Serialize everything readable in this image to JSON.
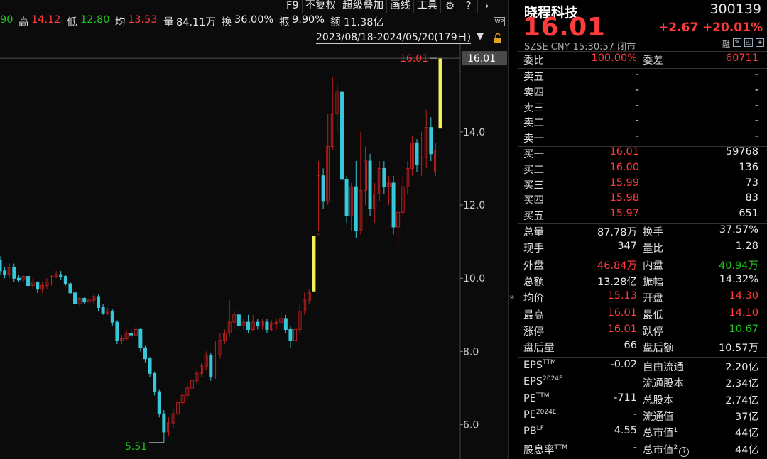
{
  "topbar": {
    "prev_close_fragment": "90",
    "high_label": "高",
    "high_value": "14.12",
    "low_label": "低",
    "low_value": "12.80",
    "avg_label": "均",
    "avg_value": "13.53",
    "vol_label": "量",
    "vol_value": "84.11万",
    "turnover_label": "换",
    "turnover_value": "36.00%",
    "amplitude_label": "振",
    "amplitude_value": "9.90%",
    "amount_label": "额",
    "amount_value": "11.38亿"
  },
  "menu": [
    "F9",
    "不复权",
    "超级叠加",
    "画线",
    "工具"
  ],
  "menu_icons": [
    "gear-icon",
    "help-icon",
    "chevron-right-icon"
  ],
  "date_range": "2023/08/18-2024/05/20(179日)",
  "wp_badge": "WP",
  "chart_data": {
    "type": "candlestick",
    "y_axis_ticks": [
      "14.0",
      "12.0",
      "10.0",
      "8.0",
      "6.0"
    ],
    "y_axis_tick_values": [
      14,
      12,
      10,
      8,
      6
    ],
    "ylim": [
      5.1,
      16.4
    ],
    "last_price_label": "16.01",
    "last_price_axis_label": "16.01",
    "min_label": "5.51",
    "min_value": 5.51,
    "up_color": "#b81e1e",
    "down_color": "#36c8d8",
    "limit_up_color": "#f4ee5a",
    "candles": [
      [
        10.5,
        10.2,
        10.6,
        10.1
      ],
      [
        10.2,
        10.1,
        10.3,
        10.0
      ],
      [
        10.1,
        10.3,
        10.4,
        10.0
      ],
      [
        10.3,
        10.0,
        10.4,
        9.9
      ],
      [
        10.0,
        9.95,
        10.1,
        9.9
      ],
      [
        9.95,
        10.05,
        10.1,
        9.9
      ],
      [
        10.05,
        9.8,
        10.1,
        9.7
      ],
      [
        9.8,
        9.9,
        10.0,
        9.7
      ],
      [
        9.9,
        9.7,
        9.9,
        9.6
      ],
      [
        9.7,
        9.8,
        9.9,
        9.6
      ],
      [
        9.8,
        9.9,
        10.0,
        9.7
      ],
      [
        9.9,
        10.05,
        10.1,
        9.8
      ],
      [
        10.05,
        10.1,
        10.2,
        10.0
      ],
      [
        10.1,
        10.05,
        10.2,
        9.95
      ],
      [
        10.05,
        9.85,
        10.1,
        9.8
      ],
      [
        9.85,
        9.6,
        9.9,
        9.55
      ],
      [
        9.6,
        9.3,
        9.7,
        9.25
      ],
      [
        9.3,
        9.45,
        9.5,
        9.25
      ],
      [
        9.45,
        9.35,
        9.5,
        9.3
      ],
      [
        9.35,
        9.4,
        9.5,
        9.3
      ],
      [
        9.4,
        9.5,
        9.55,
        9.3
      ],
      [
        9.5,
        9.2,
        9.55,
        9.1
      ],
      [
        9.2,
        9.05,
        9.3,
        9.0
      ],
      [
        9.05,
        9.1,
        9.2,
        9.0
      ],
      [
        9.1,
        8.8,
        9.15,
        8.7
      ],
      [
        8.8,
        8.3,
        8.85,
        8.2
      ],
      [
        8.3,
        8.35,
        8.45,
        8.2
      ],
      [
        8.35,
        8.5,
        8.6,
        8.3
      ],
      [
        8.5,
        8.45,
        8.6,
        8.35
      ],
      [
        8.45,
        8.6,
        8.7,
        8.4
      ],
      [
        8.6,
        8.1,
        8.65,
        8.0
      ],
      [
        8.1,
        7.8,
        8.15,
        7.7
      ],
      [
        7.8,
        7.4,
        7.85,
        7.3
      ],
      [
        7.4,
        6.9,
        7.45,
        6.8
      ],
      [
        6.9,
        6.3,
        6.95,
        6.2
      ],
      [
        6.3,
        5.8,
        6.4,
        5.51
      ],
      [
        5.8,
        6.05,
        6.2,
        5.7
      ],
      [
        6.05,
        6.3,
        6.4,
        5.9
      ],
      [
        6.3,
        6.6,
        6.7,
        6.2
      ],
      [
        6.6,
        6.8,
        6.9,
        6.5
      ],
      [
        6.8,
        7.0,
        7.1,
        6.7
      ],
      [
        7.0,
        7.2,
        7.3,
        6.9
      ],
      [
        7.2,
        7.4,
        7.5,
        7.1
      ],
      [
        7.4,
        7.6,
        7.7,
        7.3
      ],
      [
        7.6,
        7.9,
        8.0,
        7.5
      ],
      [
        7.9,
        7.3,
        7.95,
        7.2
      ],
      [
        7.3,
        7.9,
        8.3,
        7.25
      ],
      [
        7.9,
        8.3,
        8.5,
        7.8
      ],
      [
        8.3,
        8.5,
        8.6,
        8.2
      ],
      [
        8.5,
        8.8,
        9.4,
        8.4
      ],
      [
        8.8,
        9.0,
        9.1,
        8.6
      ],
      [
        9.0,
        8.7,
        9.1,
        8.6
      ],
      [
        8.7,
        8.8,
        8.9,
        8.6
      ],
      [
        8.8,
        8.6,
        9.0,
        8.5
      ],
      [
        8.6,
        8.8,
        9.0,
        8.55
      ],
      [
        8.8,
        8.7,
        8.9,
        8.6
      ],
      [
        8.7,
        8.8,
        8.9,
        8.6
      ],
      [
        8.8,
        8.6,
        8.9,
        8.5
      ],
      [
        8.6,
        8.75,
        8.85,
        8.55
      ],
      [
        8.75,
        8.8,
        8.9,
        8.6
      ],
      [
        8.8,
        8.9,
        9.1,
        8.7
      ],
      [
        8.9,
        8.6,
        9.0,
        8.5
      ],
      [
        8.6,
        8.3,
        8.7,
        8.1
      ],
      [
        8.3,
        8.6,
        8.7,
        8.2
      ],
      [
        8.6,
        9.1,
        9.3,
        8.5
      ],
      [
        9.1,
        9.4,
        9.6,
        9.0
      ],
      [
        9.4,
        9.6,
        9.7,
        9.3
      ],
      [
        9.65,
        11.15,
        11.15,
        9.65
      ],
      [
        11.2,
        12.8,
        13.2,
        11.3
      ],
      [
        12.8,
        12.1,
        13.0,
        11.9
      ],
      [
        12.1,
        13.6,
        14.5,
        12.0
      ],
      [
        13.6,
        14.5,
        15.5,
        13.5
      ],
      [
        14.5,
        15.1,
        15.3,
        14.0
      ],
      [
        15.1,
        12.7,
        15.2,
        12.5
      ],
      [
        12.7,
        11.7,
        12.8,
        11.5
      ],
      [
        11.7,
        12.5,
        12.6,
        11.3
      ],
      [
        12.5,
        11.3,
        13.2,
        11.1
      ],
      [
        11.3,
        12.4,
        14.0,
        11.2
      ],
      [
        12.4,
        13.2,
        13.6,
        12.0
      ],
      [
        13.2,
        11.9,
        13.4,
        11.7
      ],
      [
        11.9,
        12.3,
        12.6,
        11.5
      ],
      [
        12.3,
        13.0,
        13.2,
        12.1
      ],
      [
        13.0,
        12.5,
        13.2,
        12.3
      ],
      [
        12.5,
        12.6,
        12.8,
        12.0
      ],
      [
        12.6,
        11.4,
        12.8,
        11.2
      ],
      [
        11.4,
        11.8,
        12.8,
        10.9
      ],
      [
        11.8,
        12.5,
        12.8,
        11.7
      ],
      [
        12.5,
        13.0,
        13.2,
        12.3
      ],
      [
        13.0,
        13.7,
        13.9,
        12.8
      ],
      [
        13.7,
        13.1,
        13.8,
        12.9
      ],
      [
        13.1,
        13.3,
        14.0,
        12.8
      ],
      [
        13.3,
        14.12,
        14.6,
        13.0
      ],
      [
        14.12,
        13.4,
        14.4,
        13.2
      ],
      [
        12.9,
        13.5,
        13.7,
        12.8
      ],
      [
        14.1,
        16.01,
        16.01,
        14.1
      ]
    ]
  },
  "panel": {
    "name": "晓程科技",
    "code": "300139",
    "price": "16.01",
    "change": "+2.67",
    "change_pct": "+20.01%",
    "meta": "SZSE CNY 15:30:57 闭市",
    "icons": [
      "融",
      "pencil-icon",
      "expand-icon",
      "plus-icon"
    ],
    "ratio_label": "委比",
    "ratio_value": "100.00%",
    "diff_label": "委差",
    "diff_value": "60711",
    "asks": [
      {
        "label": "卖五",
        "price": "-",
        "vol": "-"
      },
      {
        "label": "卖四",
        "price": "-",
        "vol": "-"
      },
      {
        "label": "卖三",
        "price": "-",
        "vol": "-"
      },
      {
        "label": "卖二",
        "price": "-",
        "vol": "-"
      },
      {
        "label": "卖一",
        "price": "-",
        "vol": "-"
      }
    ],
    "bids": [
      {
        "label": "买一",
        "price": "16.01",
        "vol": "59768"
      },
      {
        "label": "买二",
        "price": "16.00",
        "vol": "136"
      },
      {
        "label": "买三",
        "price": "15.99",
        "vol": "73"
      },
      {
        "label": "买四",
        "price": "15.98",
        "vol": "83"
      },
      {
        "label": "买五",
        "price": "15.97",
        "vol": "651"
      }
    ],
    "stats": [
      {
        "l1": "总量",
        "v1": "87.78万",
        "c1": "white",
        "l2": "换手",
        "v2": "37.57%",
        "c2": "white"
      },
      {
        "l1": "现手",
        "v1": "347",
        "c1": "white",
        "l2": "量比",
        "v2": "1.28",
        "c2": "white"
      },
      {
        "l1": "外盘",
        "v1": "46.84万",
        "c1": "red",
        "l2": "内盘",
        "v2": "40.94万",
        "c2": "green"
      },
      {
        "l1": "总额",
        "v1": "13.28亿",
        "c1": "white",
        "l2": "振幅",
        "v2": "14.32%",
        "c2": "white"
      },
      {
        "l1": "均价",
        "v1": "15.13",
        "c1": "red",
        "l2": "开盘",
        "v2": "14.30",
        "c2": "red"
      },
      {
        "l1": "最高",
        "v1": "16.01",
        "c1": "red",
        "l2": "最低",
        "v2": "14.10",
        "c2": "red"
      },
      {
        "l1": "涨停",
        "v1": "16.01",
        "c1": "red",
        "l2": "跌停",
        "v2": "10.67",
        "c2": "green"
      },
      {
        "l1": "盘后量",
        "v1": "66",
        "c1": "white",
        "l2": "盘后额",
        "v2": "10.57万",
        "c2": "white"
      }
    ],
    "fundamentals": [
      {
        "l1": "EPS",
        "s1": "TTM",
        "v1": "-0.02",
        "l2": "自由流通",
        "s2": "",
        "v2": "2.20亿"
      },
      {
        "l1": "EPS",
        "s1": "2024E",
        "v1": "",
        "l2": "流通股本",
        "s2": "",
        "v2": "2.34亿"
      },
      {
        "l1": "PE",
        "s1": "TTM",
        "v1": "-711",
        "l2": "总股本",
        "s2": "",
        "v2": "2.74亿"
      },
      {
        "l1": "PE",
        "s1": "2024E",
        "v1": "-",
        "l2": "流通值",
        "s2": "",
        "v2": "37亿"
      },
      {
        "l1": "PB",
        "s1": "LF",
        "v1": "4.55",
        "l2": "总市值",
        "s2": "1",
        "v2": "44亿"
      },
      {
        "l1": "股息率",
        "s1": "TTM",
        "v1": "-",
        "l2": "总市值",
        "s2": "2",
        "v2": "44亿"
      }
    ],
    "info_glyph": "i"
  }
}
